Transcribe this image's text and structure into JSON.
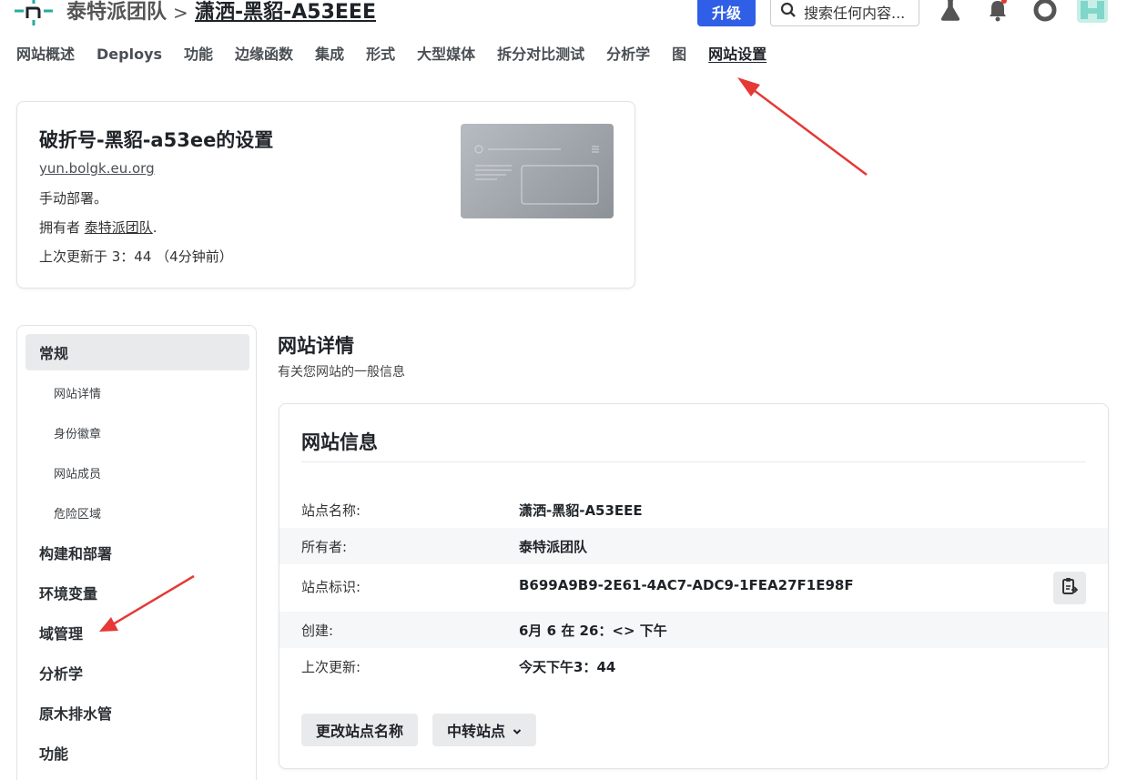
{
  "header": {
    "team_name": "泰特派团队",
    "breadcrumb_separator": ">",
    "site_name": "潇洒-黑貂-A53EEE",
    "upgrade_label": "升级",
    "search_placeholder": "搜索任何内容...",
    "icons": [
      "lab-flask-icon",
      "notification-bell-icon",
      "help-lifebuoy-icon",
      "user-avatar"
    ]
  },
  "nav": {
    "items": [
      "网站概述",
      "Deploys",
      "功能",
      "边缘函数",
      "集成",
      "形式",
      "大型媒体",
      "拆分对比测试",
      "分析学",
      "图",
      "网站设置"
    ],
    "active_index": 10
  },
  "settings_card": {
    "title": "破折号-黑貂-a53ee的设置",
    "url": "yun.bolgk.eu.org",
    "deploy_mode": "手动部署。",
    "owner_prefix": "拥有者 ",
    "owner_name": "泰特派团队",
    "owner_suffix": ".",
    "last_updated": "上次更新于 3：44 （4分钟前）"
  },
  "sidebar": {
    "items": [
      {
        "label": "常规",
        "active": true
      },
      {
        "label": "网站详情",
        "sub": true
      },
      {
        "label": "身份徽章",
        "sub": true
      },
      {
        "label": "网站成员",
        "sub": true
      },
      {
        "label": "危险区域",
        "sub": true
      },
      {
        "label": "构建和部署"
      },
      {
        "label": "环境变量"
      },
      {
        "label": "域管理"
      },
      {
        "label": "分析学"
      },
      {
        "label": "原木排水管"
      },
      {
        "label": "功能"
      }
    ]
  },
  "main": {
    "title": "网站详情",
    "subtitle": "有关您网站的一般信息",
    "info_card": {
      "title": "网站信息",
      "rows": [
        {
          "label": "站点名称:",
          "value": "潇洒-黑貂-A53EEE"
        },
        {
          "label": "所有者:",
          "value": "泰特派团队"
        },
        {
          "label": "站点标识:",
          "value": "B699A9B9-2E61-4AC7-ADC9-1FEA27F1E98F"
        },
        {
          "label": "创建:",
          "value": "6月 6 在 26：<> 下午"
        },
        {
          "label": "上次更新:",
          "value": "今天下午3：44"
        }
      ],
      "rename_button": "更改站点名称",
      "transfer_button": "中转站点"
    }
  },
  "colors": {
    "accent": "#2f5fe6",
    "logo": "#2aa8a0",
    "annotation_arrow": "#e53935",
    "notification_dot": "#e53935"
  }
}
